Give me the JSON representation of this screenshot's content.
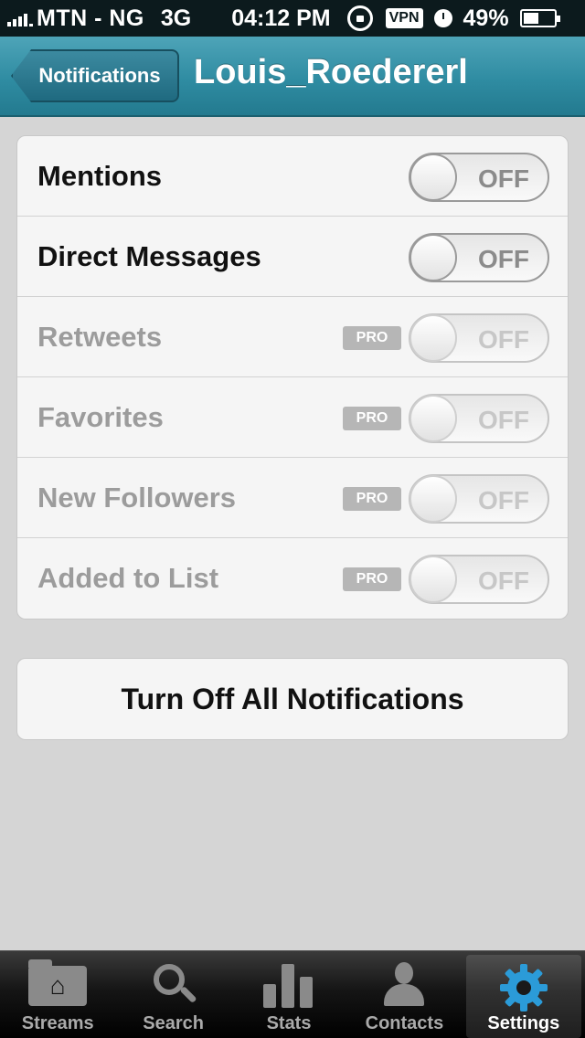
{
  "status_bar": {
    "carrier": "MTN - NG",
    "network": "3G",
    "time": "04:12 PM",
    "vpn": "VPN",
    "battery_percent_text": "49%",
    "battery_level": 0.49
  },
  "nav": {
    "back_label": "Notifications",
    "title": "Louis_Roedererl"
  },
  "settings": {
    "rows": [
      {
        "label": "Mentions",
        "state": "OFF",
        "pro": "",
        "enabled": true
      },
      {
        "label": "Direct Messages",
        "state": "OFF",
        "pro": "",
        "enabled": true
      },
      {
        "label": "Retweets",
        "state": "OFF",
        "pro": "PRO",
        "enabled": false
      },
      {
        "label": "Favorites",
        "state": "OFF",
        "pro": "PRO",
        "enabled": false
      },
      {
        "label": "New Followers",
        "state": "OFF",
        "pro": "PRO",
        "enabled": false
      },
      {
        "label": "Added to List",
        "state": "OFF",
        "pro": "PRO",
        "enabled": false
      }
    ]
  },
  "actions": {
    "turn_off_all": "Turn Off All Notifications"
  },
  "tabbar": {
    "tabs": [
      {
        "label": "Streams",
        "icon": "folder-home-icon",
        "active": false
      },
      {
        "label": "Search",
        "icon": "search-icon",
        "active": false
      },
      {
        "label": "Stats",
        "icon": "bar-chart-icon",
        "active": false
      },
      {
        "label": "Contacts",
        "icon": "person-icon",
        "active": false
      },
      {
        "label": "Settings",
        "icon": "gear-icon",
        "active": true
      }
    ]
  },
  "colors": {
    "nav_bar": "#2f8ca2",
    "active_tab_icon": "#2b9bd8"
  }
}
